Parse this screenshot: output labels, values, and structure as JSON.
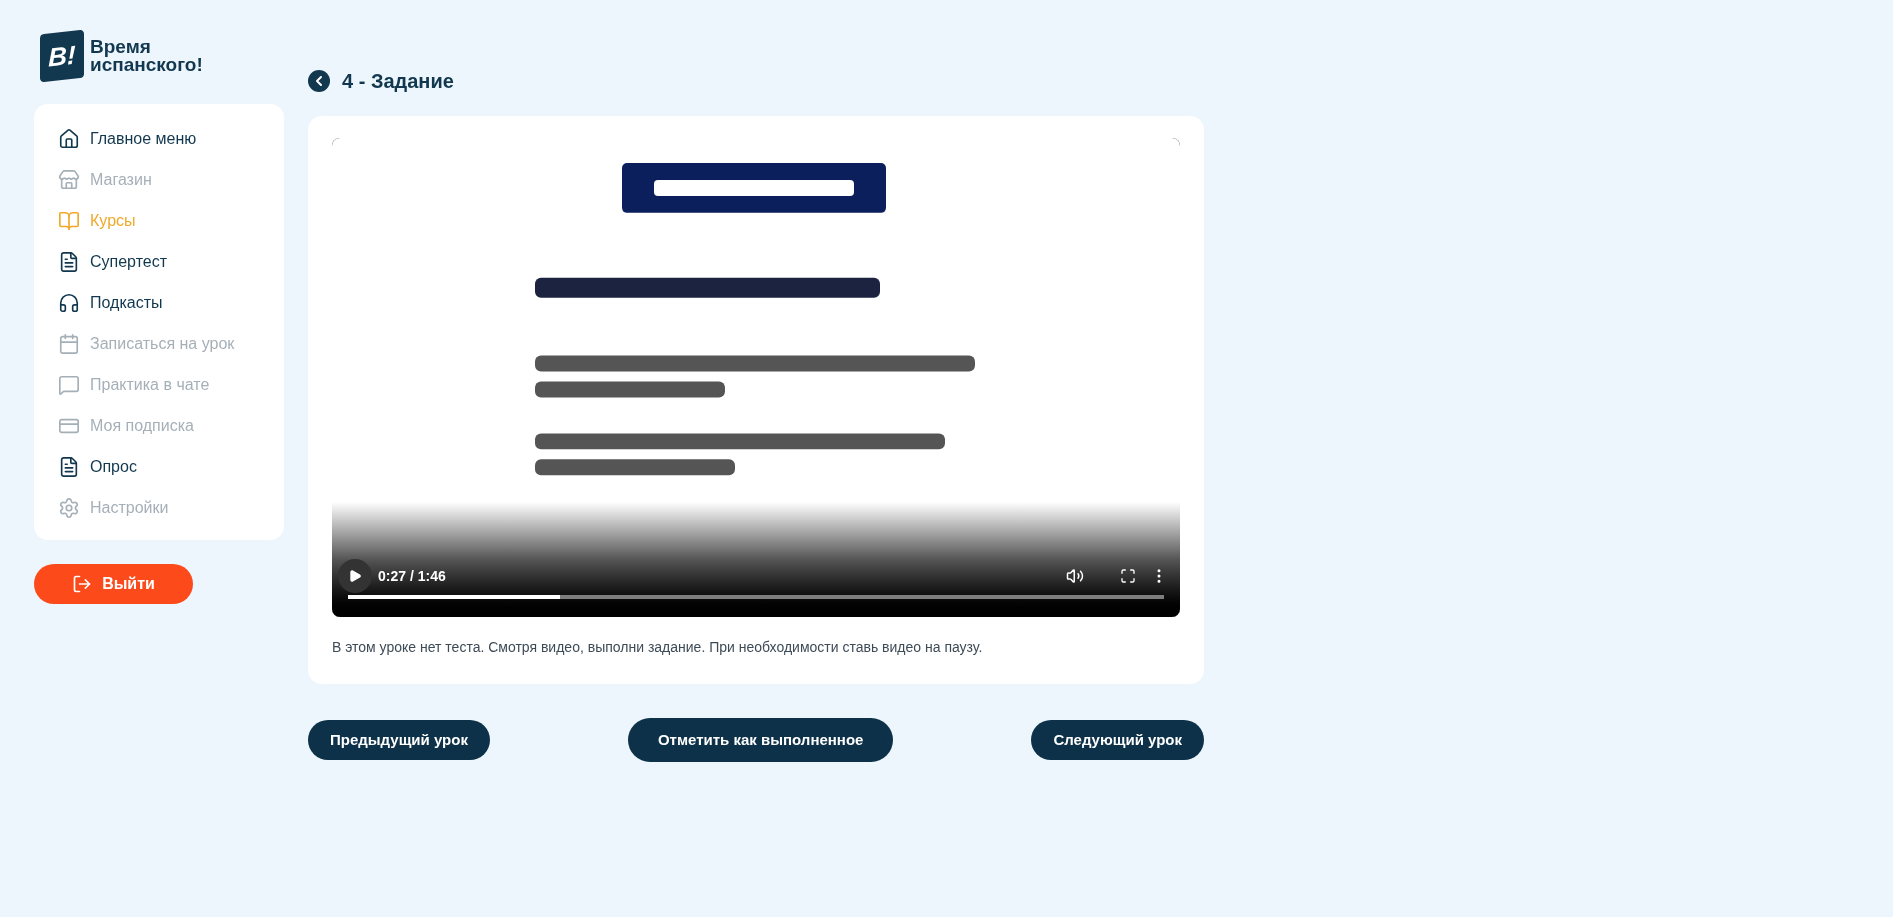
{
  "logo": {
    "mark": "B!",
    "line1": "Время",
    "line2": "испанского!"
  },
  "sidebar": {
    "items": [
      {
        "label": "Главное меню",
        "selected": false,
        "disabled": false
      },
      {
        "label": "Магазин",
        "selected": false,
        "disabled": true
      },
      {
        "label": "Курсы",
        "selected": true,
        "disabled": false
      },
      {
        "label": "Супертест",
        "selected": false,
        "disabled": false
      },
      {
        "label": "Подкасты",
        "selected": false,
        "disabled": false
      },
      {
        "label": "Записаться на урок",
        "selected": false,
        "disabled": true
      },
      {
        "label": "Практика в чате",
        "selected": false,
        "disabled": true
      },
      {
        "label": "Моя подписка",
        "selected": false,
        "disabled": true
      },
      {
        "label": "Опрос",
        "selected": false,
        "disabled": false
      },
      {
        "label": "Настройки",
        "selected": false,
        "disabled": true
      }
    ]
  },
  "logout": {
    "label": "Выйти"
  },
  "header": {
    "title": "4 - Задание"
  },
  "video": {
    "kind": "picture",
    "time": "0:27 / 1:46",
    "progress": {
      "level": 0.26
    }
  },
  "note": "В этом уроке нет теста. Смотря видео, выполни задание. При необходимости ставь видео на паузу.",
  "buttons": [
    {
      "label": "Предыдущий урок"
    },
    {
      "label": "Отметить как выполненное"
    },
    {
      "label": "Следующий урок"
    }
  ]
}
